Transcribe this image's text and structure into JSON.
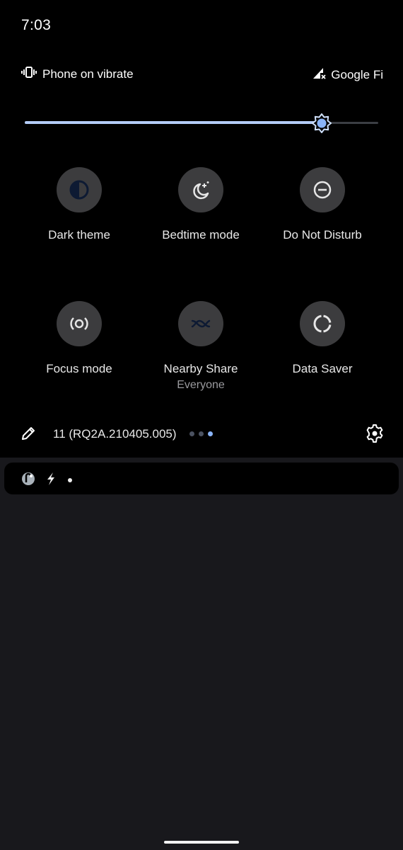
{
  "status_bar": {
    "time": "7:03"
  },
  "quick_settings": {
    "ringer_status": {
      "icon": "vibrate-icon",
      "label": "Phone on vibrate"
    },
    "carrier": {
      "icon": "signal-no-service-icon",
      "label": "Google Fi"
    },
    "brightness": {
      "value_percent": 84,
      "icon": "brightness-icon"
    },
    "tiles": [
      {
        "label": "Dark theme",
        "sublabel": "",
        "icon": "dark-theme-icon",
        "state": "on"
      },
      {
        "label": "Bedtime mode",
        "sublabel": "",
        "icon": "bedtime-moon-icon",
        "state": "off"
      },
      {
        "label": "Do Not Disturb",
        "sublabel": "",
        "icon": "do-not-disturb-icon",
        "state": "off"
      },
      {
        "label": "Focus mode",
        "sublabel": "",
        "icon": "focus-mode-icon",
        "state": "off"
      },
      {
        "label": "Nearby Share",
        "sublabel": "Everyone",
        "icon": "nearby-share-icon",
        "state": "on"
      },
      {
        "label": "Data Saver",
        "sublabel": "",
        "icon": "data-saver-icon",
        "state": "off"
      }
    ],
    "footer": {
      "edit_icon": "pencil-icon",
      "build_number": "11 (RQ2A.210405.005)",
      "page_count": 3,
      "current_page": 3,
      "settings_icon": "gear-icon"
    }
  },
  "notification_shelf": {
    "icons": [
      "app-notification-icon",
      "bolt-icon",
      "dot-icon"
    ]
  },
  "colors": {
    "accent": "#8ab4f8",
    "panel_bg": "#000000",
    "screen_bg": "#18181c",
    "tile_off_bg": "#3c3c3e"
  }
}
